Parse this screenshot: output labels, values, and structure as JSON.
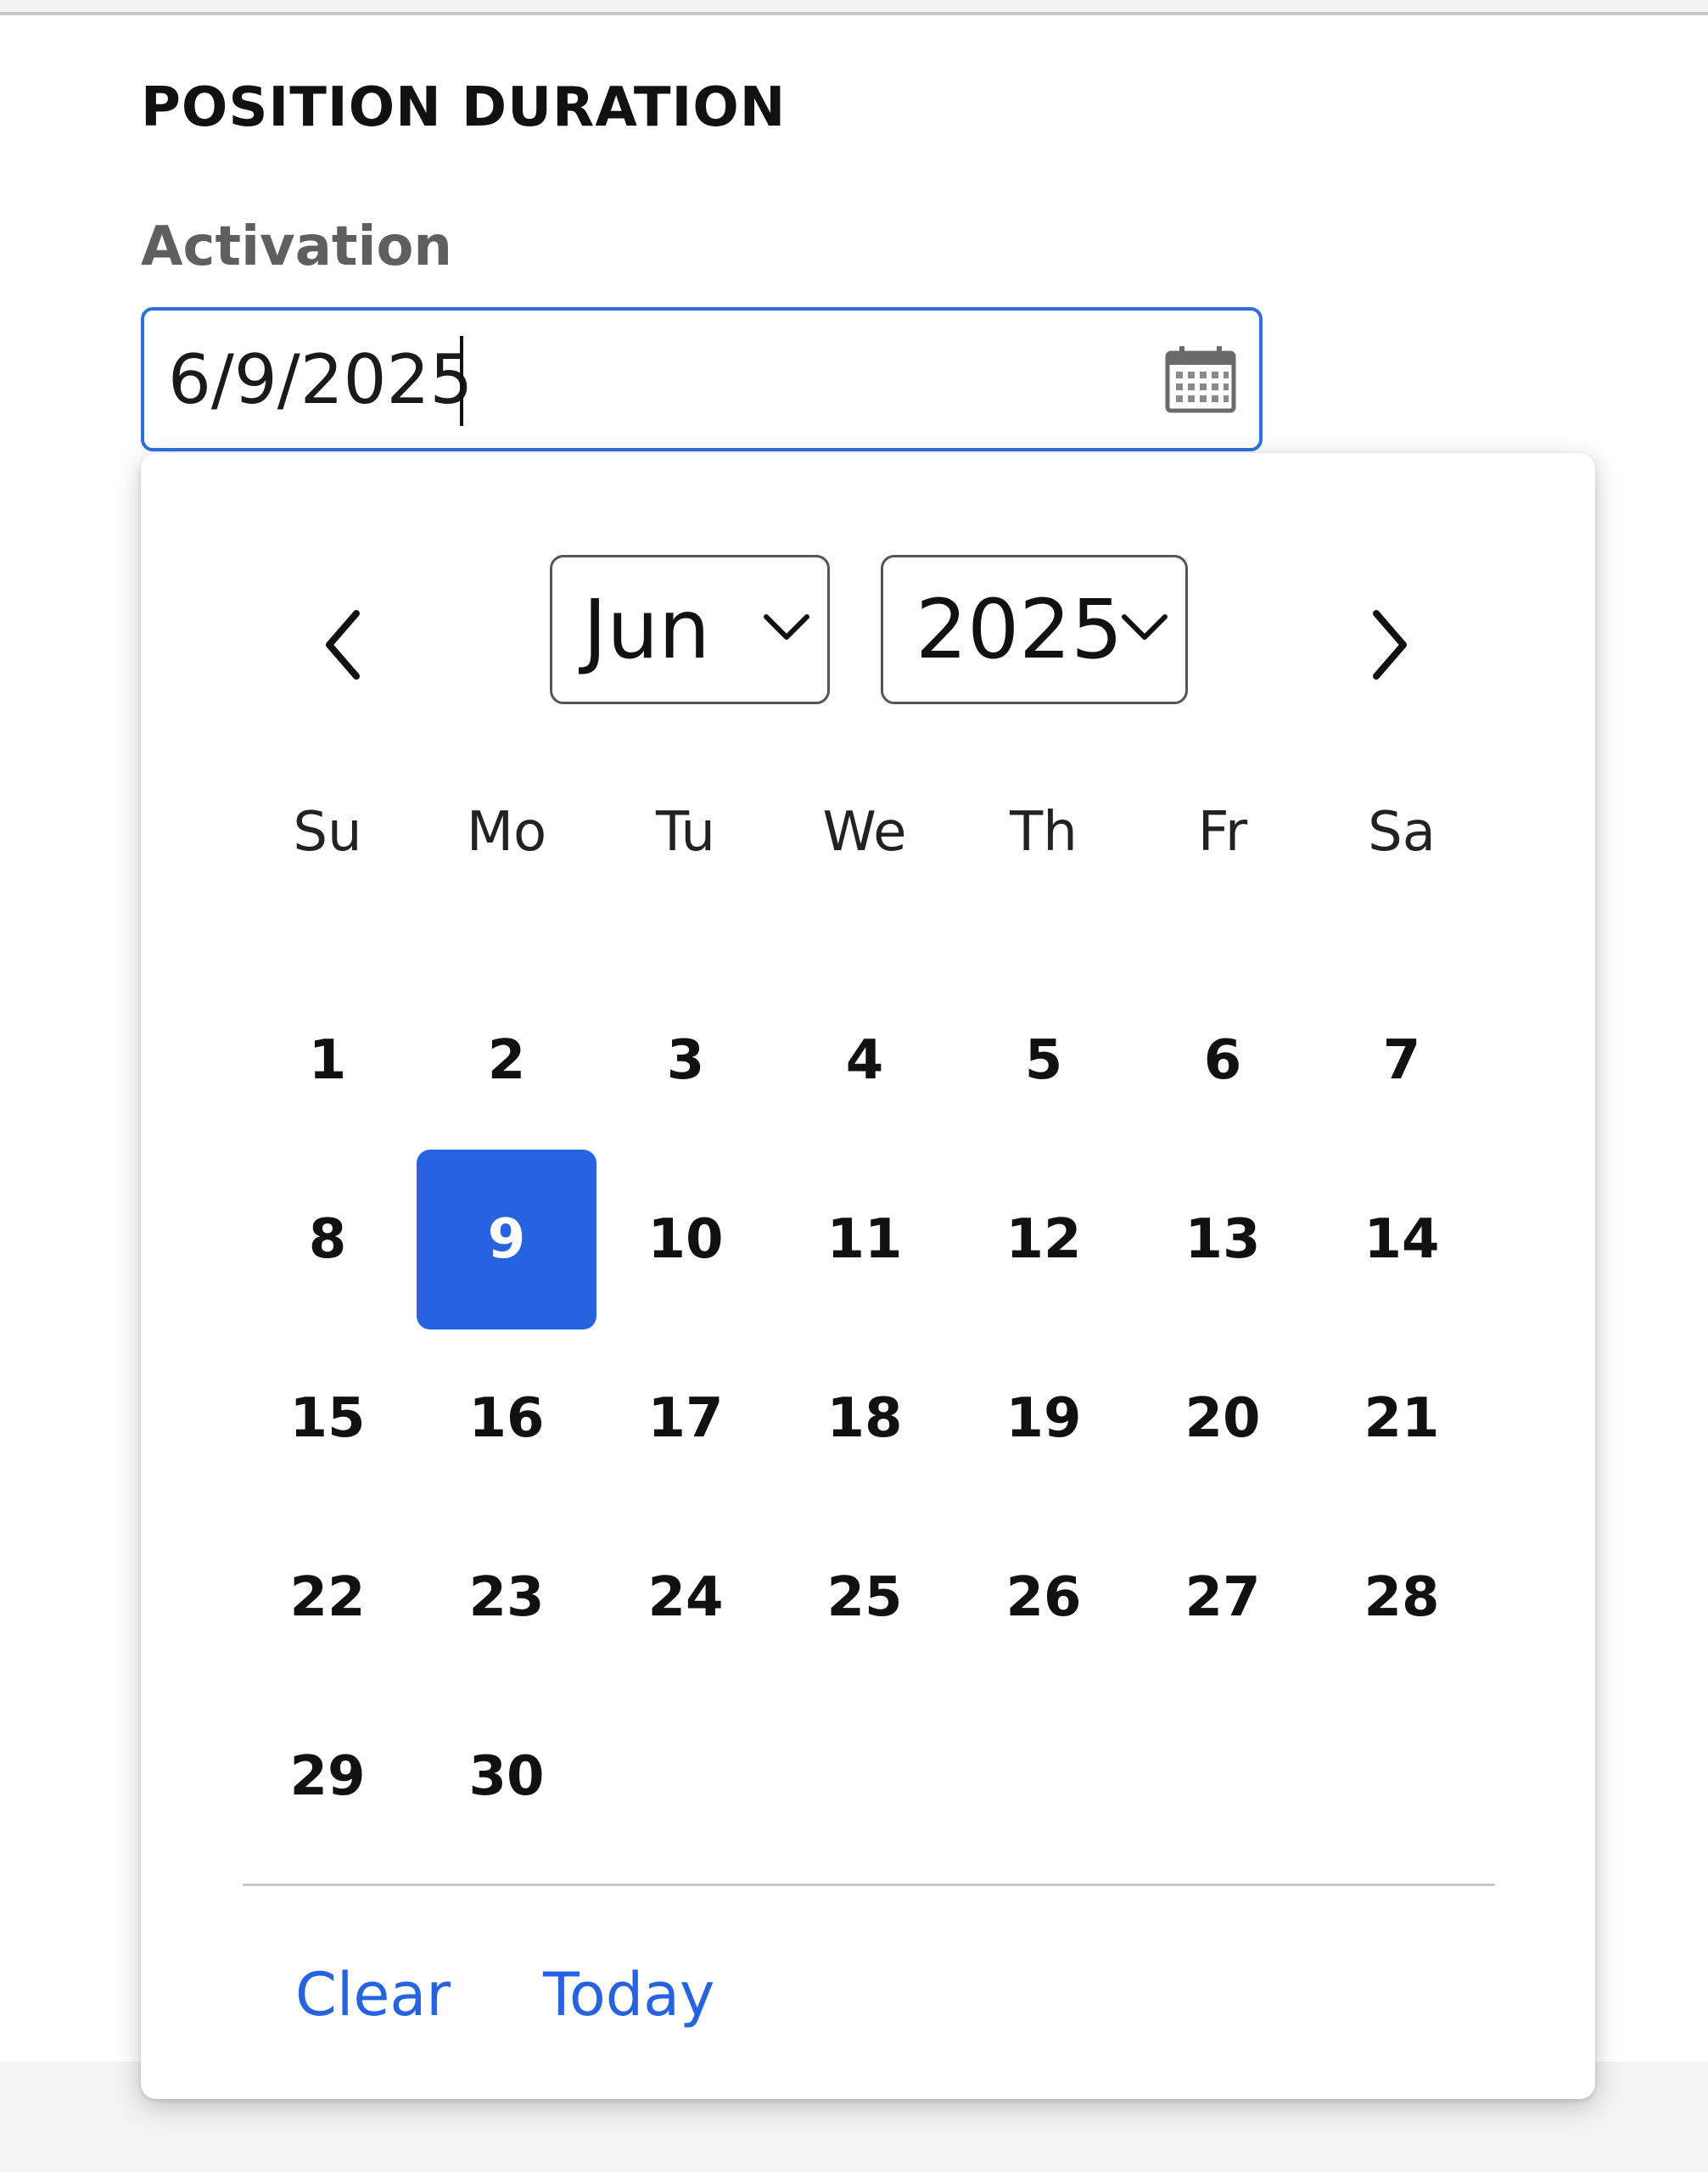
{
  "section": {
    "title": "POSITION DURATION"
  },
  "activation": {
    "label": "Activation",
    "value": "6/9/2025"
  },
  "calendar": {
    "month_selected": "Jun",
    "year_selected": "2025",
    "weekdays": [
      "Su",
      "Mo",
      "Tu",
      "We",
      "Th",
      "Fr",
      "Sa"
    ],
    "days": [
      "1",
      "2",
      "3",
      "4",
      "5",
      "6",
      "7",
      "8",
      "9",
      "10",
      "11",
      "12",
      "13",
      "14",
      "15",
      "16",
      "17",
      "18",
      "19",
      "20",
      "21",
      "22",
      "23",
      "24",
      "25",
      "26",
      "27",
      "28",
      "29",
      "30"
    ],
    "first_weekday_index": 0,
    "selected_day": "9",
    "footer": {
      "clear": "Clear",
      "today": "Today"
    }
  },
  "colors": {
    "accent": "#2563e0",
    "focus_border": "#2e6fe0"
  },
  "icons": {
    "calendar": "calendar-icon",
    "prev": "chevron-left-icon",
    "next": "chevron-right-icon",
    "dropdown": "chevron-down-icon"
  }
}
